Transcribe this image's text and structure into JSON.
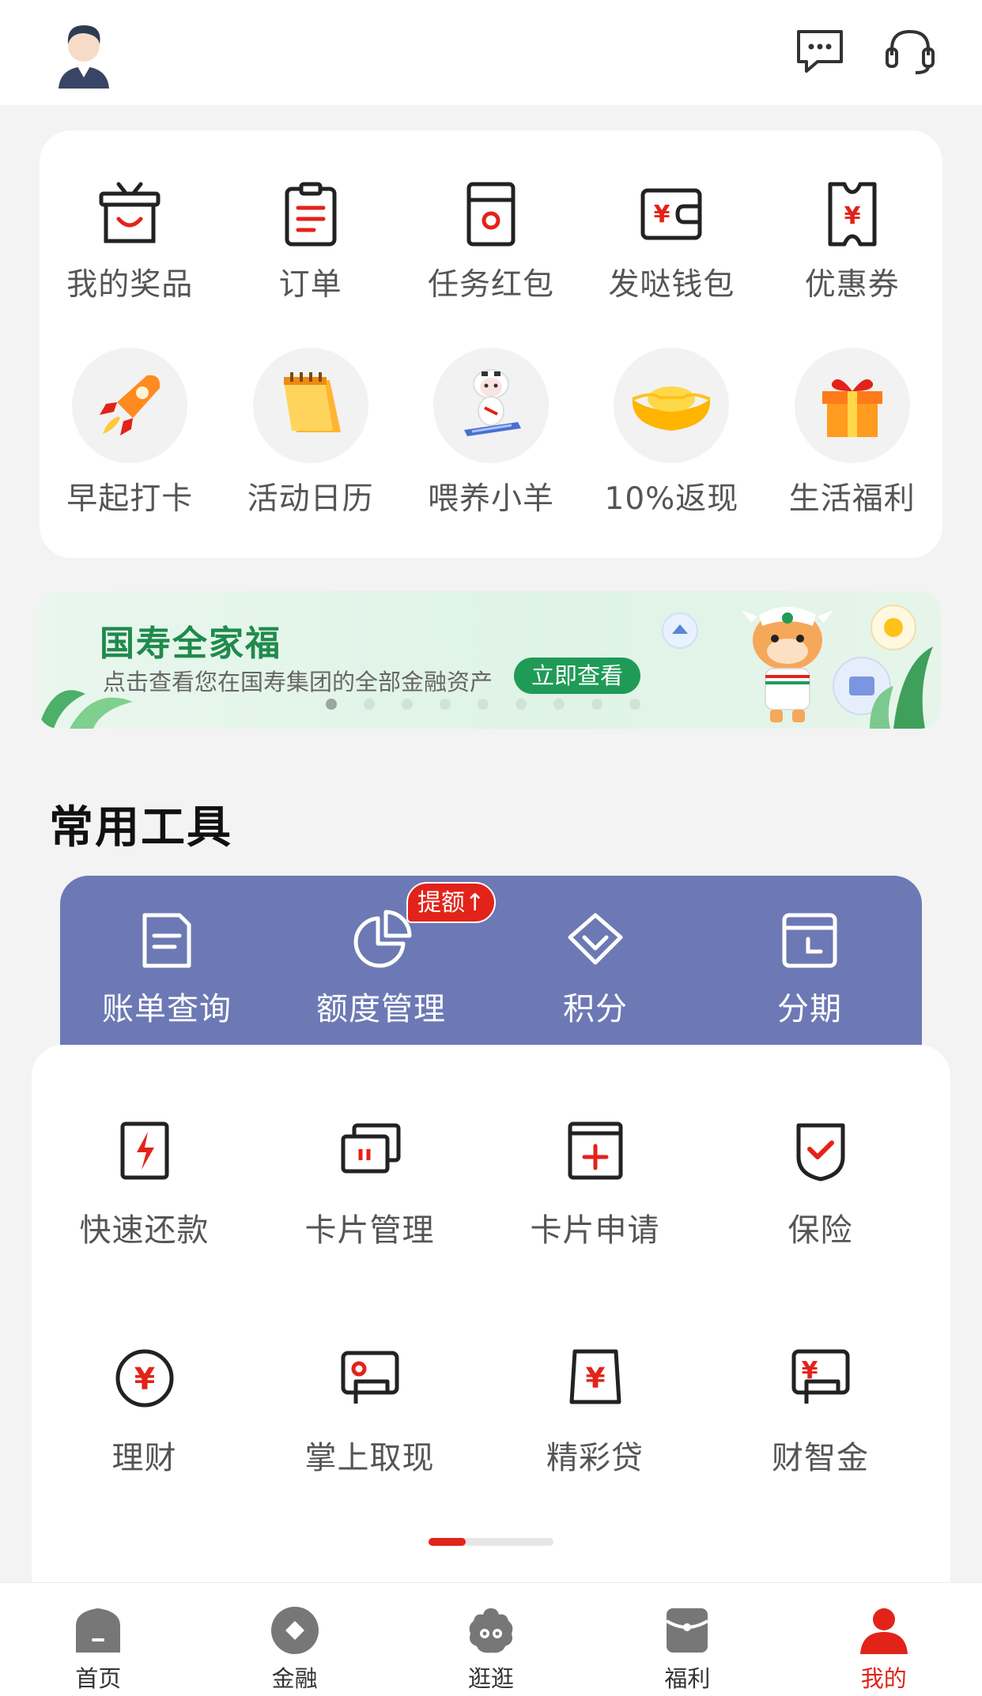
{
  "colors": {
    "accent": "#e2231a",
    "tools_bar": "#6c79b4",
    "banner_green": "#1f8a4c"
  },
  "header": {
    "avatar_icon": "user-avatar",
    "message_icon": "chat-message-icon",
    "service_icon": "headset-icon"
  },
  "quick_row1": [
    {
      "label": "我的奖品",
      "icon": "prize-basket-icon"
    },
    {
      "label": "订单",
      "icon": "clipboard-icon"
    },
    {
      "label": "任务红包",
      "icon": "red-envelope-icon"
    },
    {
      "label": "发哒钱包",
      "icon": "wallet-icon"
    },
    {
      "label": "优惠券",
      "icon": "coupon-icon"
    }
  ],
  "quick_row2": [
    {
      "label": "早起打卡",
      "icon": "rocket-icon"
    },
    {
      "label": "活动日历",
      "icon": "calendar-icon"
    },
    {
      "label": "喂养小羊",
      "icon": "sheep-icon"
    },
    {
      "label": "10%返现",
      "icon": "gold-ingot-icon"
    },
    {
      "label": "生活福利",
      "icon": "gift-box-icon"
    }
  ],
  "banner": {
    "title": "国寿全家福",
    "subtitle": "点击查看您在国寿集团的全部金融资产",
    "cta": "立即查看",
    "dot_count": 9,
    "active_dot": 0
  },
  "tools": {
    "section_title": "常用工具",
    "bar": [
      {
        "label": "账单查询",
        "icon": "bill-icon"
      },
      {
        "label": "额度管理",
        "icon": "pie-chart-icon"
      },
      {
        "label": "积分",
        "icon": "diamond-icon"
      },
      {
        "label": "分期",
        "icon": "installment-icon"
      }
    ],
    "badge": "提额↑",
    "grid_row1": [
      {
        "label": "快速还款",
        "icon": "lightning-card-icon"
      },
      {
        "label": "卡片管理",
        "icon": "cards-icon"
      },
      {
        "label": "卡片申请",
        "icon": "card-add-icon"
      },
      {
        "label": "保险",
        "icon": "shield-check-icon"
      }
    ],
    "grid_row2": [
      {
        "label": "理财",
        "icon": "yuan-circle-icon"
      },
      {
        "label": "掌上取现",
        "icon": "cash-withdraw-icon"
      },
      {
        "label": "精彩贷",
        "icon": "loan-bag-icon"
      },
      {
        "label": "财智金",
        "icon": "yuan-wallet-icon"
      }
    ],
    "scroll_progress": 0.3
  },
  "bottom_nav": [
    {
      "label": "首页",
      "icon": "home-icon",
      "active": false
    },
    {
      "label": "金融",
      "icon": "finance-icon",
      "active": false
    },
    {
      "label": "逛逛",
      "icon": "explore-icon",
      "active": false
    },
    {
      "label": "福利",
      "icon": "welfare-icon",
      "active": false
    },
    {
      "label": "我的",
      "icon": "profile-icon",
      "active": true
    }
  ]
}
